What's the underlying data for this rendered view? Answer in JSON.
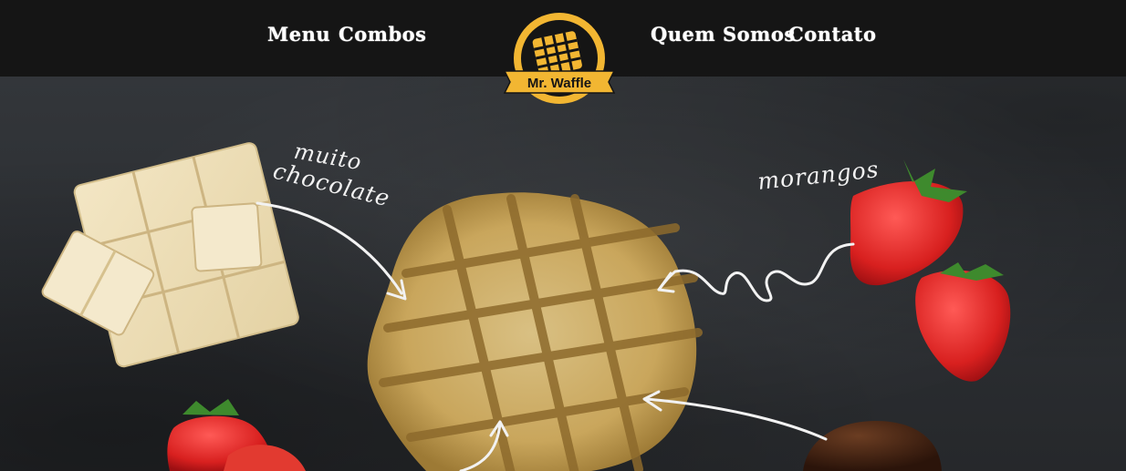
{
  "nav": {
    "menu": "Menu",
    "combos": "Combos",
    "quem_somos": "Quem Somos",
    "contato": "Contato"
  },
  "logo": {
    "name": "Mr. Waffle"
  },
  "labels": {
    "muito": "muito",
    "chocolate": "chocolate",
    "morangos": "morangos"
  },
  "colors": {
    "header_bg": "#151515",
    "logo_gold": "#f2b632",
    "board": "#2e3135",
    "chalk": "#f2f2f2"
  }
}
